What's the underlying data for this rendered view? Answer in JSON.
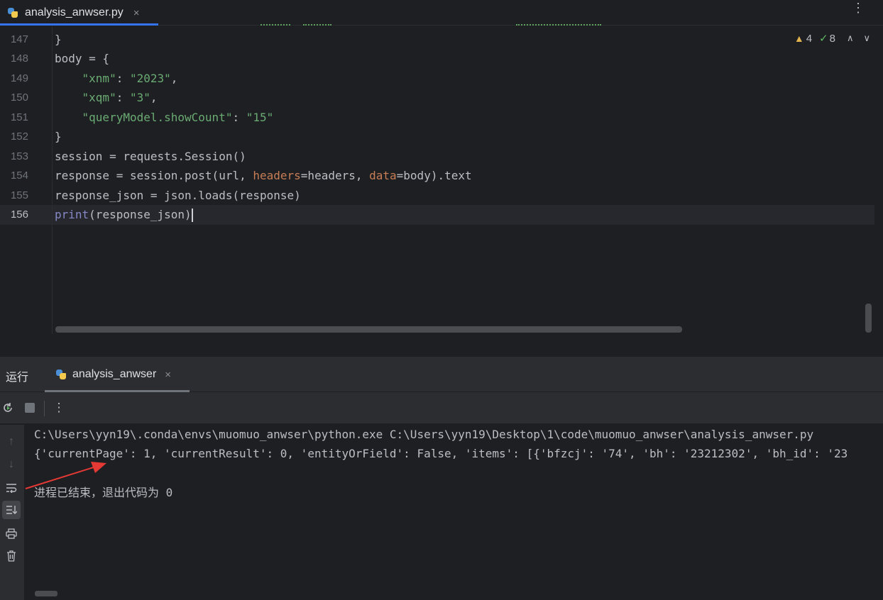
{
  "editor_tab": {
    "filename": "analysis_anwser.py",
    "close": "×"
  },
  "tab_more": "⋮",
  "inspections": {
    "warnings": "4",
    "weak_warnings": "8"
  },
  "editor": {
    "lines": [
      {
        "n": "147",
        "text": "}"
      },
      {
        "n": "148",
        "text": "body = {"
      },
      {
        "n": "149",
        "key": "\"xnm\"",
        "val": "\"2023\""
      },
      {
        "n": "150",
        "key": "\"xqm\"",
        "val": "\"3\""
      },
      {
        "n": "151",
        "key": "\"queryModel.showCount\"",
        "val": "\"15\""
      },
      {
        "n": "152",
        "text": "}"
      },
      {
        "n": "153",
        "text": "session = requests.Session()"
      },
      {
        "n": "154",
        "pre": "response = session.post(url, ",
        "p1": "headers",
        "mid": "=headers, ",
        "p2": "data",
        "post": "=body).text"
      },
      {
        "n": "155",
        "text": "response_json = json.loads(response)"
      },
      {
        "n": "156",
        "fn": "print",
        "args": "(response_json)"
      }
    ]
  },
  "run_panel": {
    "title": "运行",
    "tab_name": "analysis_anwser",
    "tab_close": "×"
  },
  "toolbar": {
    "more": "⋮"
  },
  "console": {
    "command": "C:\\Users\\yyn19\\.conda\\envs\\muomuo_anwser\\python.exe C:\\Users\\yyn19\\Desktop\\1\\code\\muomuo_anwser\\analysis_anwser.py",
    "output": "{'currentPage': 1, 'currentResult': 0, 'entityOrField': False, 'items': [{'bfzcj': '74', 'bh': '23212302', 'bh_id': '23",
    "exit_message": "进程已结束，退出代码为 0"
  },
  "colors": {
    "accent": "#3574f0",
    "string": "#6aab73",
    "param": "#c77d55",
    "builtin": "#8888c6",
    "annotation_arrow": "#e53935"
  }
}
